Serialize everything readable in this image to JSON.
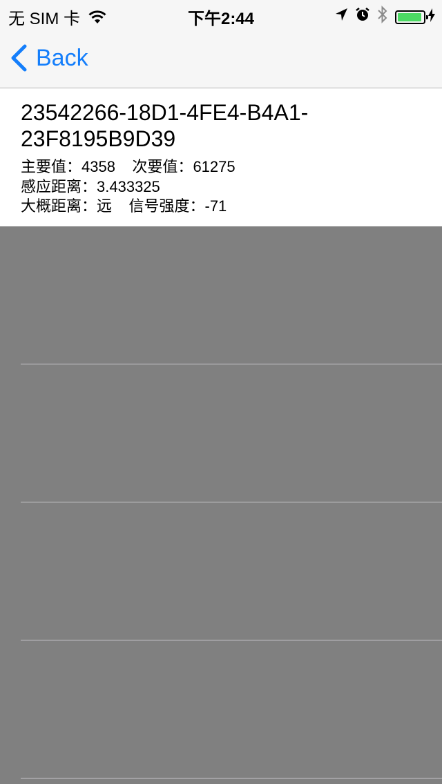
{
  "status_bar": {
    "carrier": "无 SIM 卡",
    "time": "下午2:44",
    "battery_level": 0.95,
    "icons": [
      "wifi-icon",
      "location-arrow-icon",
      "alarm-icon",
      "bluetooth-icon",
      "battery-icon",
      "charging-bolt-icon"
    ]
  },
  "nav": {
    "back_label": "Back",
    "accent_color": "#147efb"
  },
  "beacon": {
    "uuid": "23542266-18D1-4FE4-B4A1-23F8195B9D39",
    "major_label": "主要值：",
    "major_value": "4358",
    "minor_label": "次要值：",
    "minor_value": "61275",
    "accuracy_label": "感应距离：",
    "accuracy_value": "3.433325",
    "proximity_label": "大概距离：",
    "proximity_value": "远",
    "rssi_label": "信号强度：",
    "rssi_value": "-71"
  },
  "colors": {
    "background": "#808080",
    "row_background": "#ffffff",
    "battery_fill": "#4cd964"
  }
}
